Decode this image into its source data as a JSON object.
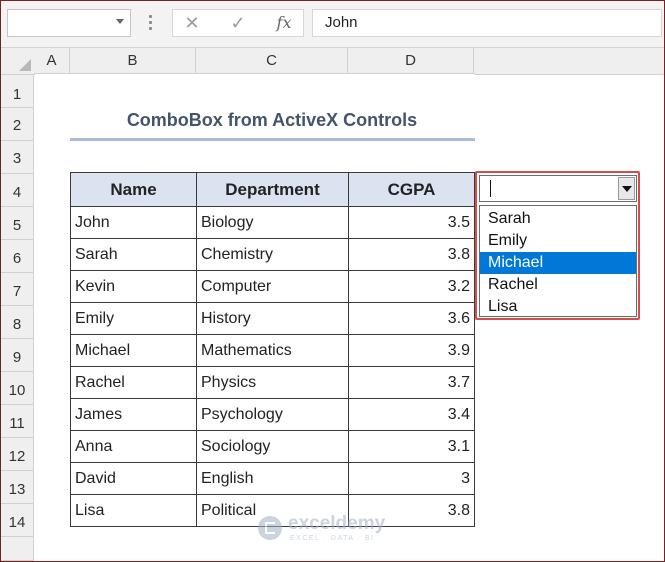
{
  "formula_bar": {
    "name_box": "",
    "cancel_icon": "✕",
    "enter_icon": "✓",
    "fx_label": "fx",
    "formula_value": "John"
  },
  "columns": [
    "A",
    "B",
    "C",
    "D"
  ],
  "rows": [
    "1",
    "2",
    "3",
    "4",
    "5",
    "6",
    "7",
    "8",
    "9",
    "10",
    "11",
    "12",
    "13",
    "14"
  ],
  "title": "ComboBox from ActiveX Controls",
  "table": {
    "headers": {
      "name": "Name",
      "department": "Department",
      "cgpa": "CGPA"
    },
    "rows": [
      {
        "name": "John",
        "department": "Biology",
        "cgpa": "3.5"
      },
      {
        "name": "Sarah",
        "department": "Chemistry",
        "cgpa": "3.8"
      },
      {
        "name": "Kevin",
        "department": "Computer",
        "cgpa": "3.2"
      },
      {
        "name": "Emily",
        "department": "History",
        "cgpa": "3.6"
      },
      {
        "name": "Michael",
        "department": "Mathematics",
        "cgpa": "3.9"
      },
      {
        "name": "Rachel",
        "department": "Physics",
        "cgpa": "3.7"
      },
      {
        "name": "James",
        "department": "Psychology",
        "cgpa": "3.4"
      },
      {
        "name": "Anna",
        "department": "Sociology",
        "cgpa": "3.1"
      },
      {
        "name": "David",
        "department": "English",
        "cgpa": "3"
      },
      {
        "name": "Lisa",
        "department": "Political",
        "cgpa": "3.8"
      }
    ]
  },
  "combobox": {
    "value": "",
    "options": [
      "Sarah",
      "Emily",
      "Michael",
      "Rachel",
      "Lisa"
    ],
    "highlighted": "Michael",
    "highlight_color": "#0078d7",
    "outline_color": "#d84b4b"
  },
  "watermark": {
    "name": "exceldemy",
    "tagline": "EXCEL · DATA · BI"
  }
}
